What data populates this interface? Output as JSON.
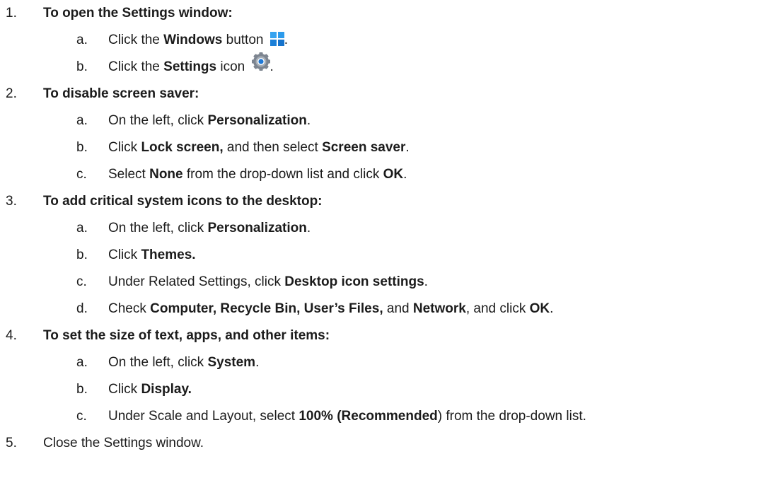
{
  "steps": [
    {
      "num": "1.",
      "title": "To open the Settings window:",
      "subs": [
        {
          "letter": "a.",
          "parts": [
            "Click the ",
            "Windows",
            " button ",
            "",
            "."
          ]
        },
        {
          "letter": "b.",
          "parts": [
            "Click the ",
            "Settings",
            " icon ",
            "",
            "."
          ]
        }
      ]
    },
    {
      "num": "2.",
      "title": "To disable screen saver:",
      "subs": [
        {
          "letter": "a.",
          "parts": [
            "On the left, click ",
            "Personalization",
            "."
          ]
        },
        {
          "letter": "b.",
          "parts": [
            "Click ",
            "Lock screen,",
            " and then select ",
            "Screen saver",
            "."
          ]
        },
        {
          "letter": "c.",
          "parts": [
            "Select ",
            "None",
            " from the drop-down list and click ",
            "OK",
            "."
          ]
        }
      ]
    },
    {
      "num": "3.",
      "title": "To add critical system icons to the desktop:",
      "subs": [
        {
          "letter": "a.",
          "parts": [
            "On the left, click ",
            "Personalization",
            "."
          ]
        },
        {
          "letter": "b.",
          "parts": [
            "Click ",
            "Themes.",
            ""
          ]
        },
        {
          "letter": "c.",
          "parts": [
            "Under Related Settings, click ",
            "Desktop icon settings",
            "."
          ]
        },
        {
          "letter": "d.",
          "parts": [
            "Check ",
            "Computer, Recycle Bin, User’s Files,",
            " and ",
            "Network",
            ", and click ",
            "OK",
            "."
          ]
        }
      ]
    },
    {
      "num": "4.",
      "title": "To set the size of text, apps, and other items:",
      "subs": [
        {
          "letter": "a.",
          "parts": [
            "On the left, click ",
            "System",
            "."
          ]
        },
        {
          "letter": "b.",
          "parts": [
            "Click ",
            "Display.",
            ""
          ]
        },
        {
          "letter": "c.",
          "parts": [
            "Under Scale and Layout, select ",
            "100% (Recommended",
            ") from the drop-down list."
          ]
        }
      ]
    },
    {
      "num": "5.",
      "title": "Close the Settings window.",
      "subs": []
    }
  ],
  "icons": {
    "windows": "windows-logo-icon",
    "settings": "settings-gear-icon",
    "accent": "#1e90e6"
  }
}
